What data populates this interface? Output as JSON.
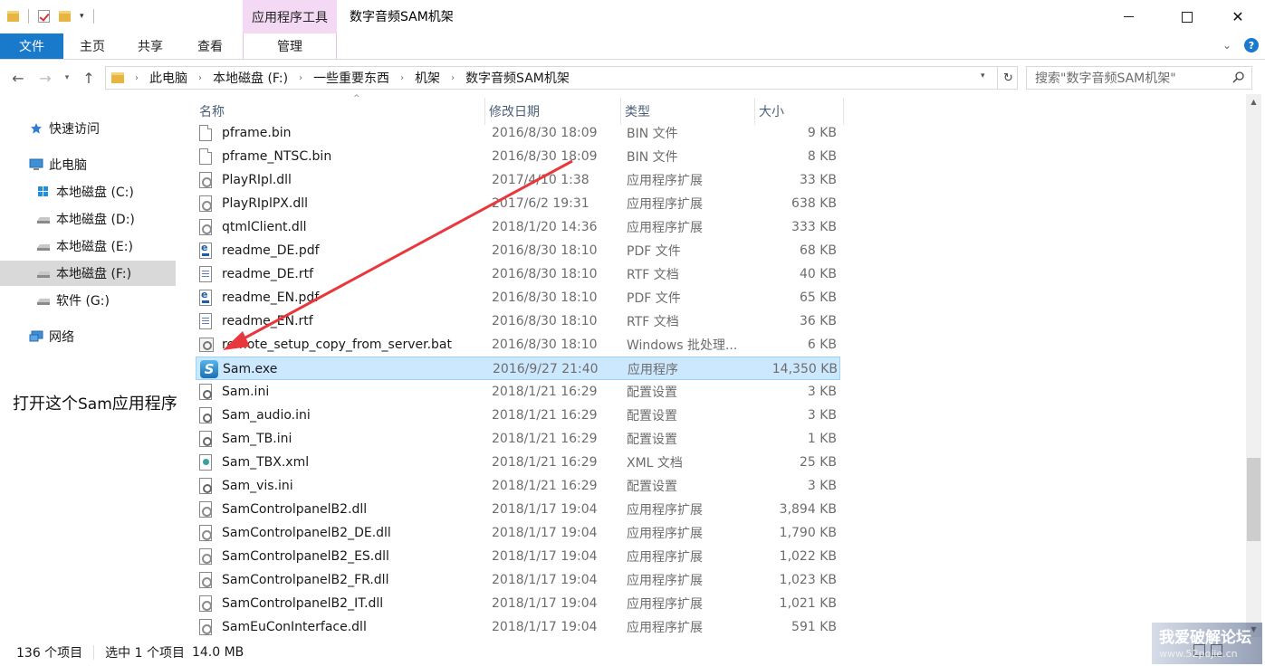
{
  "window": {
    "title": "数字音频SAM机架",
    "context_tab": "应用程序工具"
  },
  "ribbon": {
    "tabs": [
      {
        "label": "文件"
      },
      {
        "label": "主页"
      },
      {
        "label": "共享"
      },
      {
        "label": "查看"
      },
      {
        "label": "管理"
      }
    ]
  },
  "address": {
    "crumbs": [
      "此电脑",
      "本地磁盘 (F:)",
      "一些重要东西",
      "机架",
      "数字音频SAM机架"
    ]
  },
  "search": {
    "placeholder": "搜索\"数字音频SAM机架\""
  },
  "navpane": {
    "items": [
      {
        "label": "快速访问",
        "icon": "star-icon"
      },
      {
        "label": "此电脑",
        "icon": "computer-icon"
      },
      {
        "label": "本地磁盘 (C:)",
        "icon": "windows-drive-icon"
      },
      {
        "label": "本地磁盘 (D:)",
        "icon": "drive-icon"
      },
      {
        "label": "本地磁盘 (E:)",
        "icon": "drive-icon"
      },
      {
        "label": "本地磁盘 (F:)",
        "icon": "drive-icon"
      },
      {
        "label": "软件 (G:)",
        "icon": "drive-icon"
      },
      {
        "label": "网络",
        "icon": "network-icon"
      }
    ]
  },
  "annotation": {
    "prefix": "打开这个",
    "bold": "Sam",
    "suffix": "应用程序"
  },
  "columns": {
    "name": "名称",
    "date": "修改日期",
    "type": "类型",
    "size": "大小"
  },
  "files": [
    {
      "name": "pframe.bin",
      "date": "2016/8/30 18:09",
      "type": "BIN 文件",
      "size": "9 KB",
      "icon": "file"
    },
    {
      "name": "pframe_NTSC.bin",
      "date": "2016/8/30 18:09",
      "type": "BIN 文件",
      "size": "8 KB",
      "icon": "file"
    },
    {
      "name": "PlayRIpl.dll",
      "date": "2017/4/10 1:38",
      "type": "应用程序扩展",
      "size": "33 KB",
      "icon": "dll"
    },
    {
      "name": "PlayRIplPX.dll",
      "date": "2017/6/2 19:31",
      "type": "应用程序扩展",
      "size": "638 KB",
      "icon": "dll"
    },
    {
      "name": "qtmlClient.dll",
      "date": "2018/1/20 14:36",
      "type": "应用程序扩展",
      "size": "333 KB",
      "icon": "dll"
    },
    {
      "name": "readme_DE.pdf",
      "date": "2016/8/30 18:10",
      "type": "PDF 文件",
      "size": "68 KB",
      "icon": "pdf"
    },
    {
      "name": "readme_DE.rtf",
      "date": "2016/8/30 18:10",
      "type": "RTF 文档",
      "size": "40 KB",
      "icon": "rtf"
    },
    {
      "name": "readme_EN.pdf",
      "date": "2016/8/30 18:10",
      "type": "PDF 文件",
      "size": "65 KB",
      "icon": "pdf"
    },
    {
      "name": "readme_EN.rtf",
      "date": "2016/8/30 18:10",
      "type": "RTF 文档",
      "size": "36 KB",
      "icon": "rtf"
    },
    {
      "name": "remote_setup_copy_from_server.bat",
      "date": "2016/8/30 18:10",
      "type": "Windows 批处理...",
      "size": "6 KB",
      "icon": "bat"
    },
    {
      "name": "Sam.exe",
      "date": "2016/9/27 21:40",
      "type": "应用程序",
      "size": "14,350 KB",
      "icon": "exe",
      "selected": true
    },
    {
      "name": "Sam.ini",
      "date": "2018/1/21 16:29",
      "type": "配置设置",
      "size": "3 KB",
      "icon": "ini"
    },
    {
      "name": "Sam_audio.ini",
      "date": "2018/1/21 16:29",
      "type": "配置设置",
      "size": "3 KB",
      "icon": "ini"
    },
    {
      "name": "Sam_TB.ini",
      "date": "2018/1/21 16:29",
      "type": "配置设置",
      "size": "1 KB",
      "icon": "ini"
    },
    {
      "name": "Sam_TBX.xml",
      "date": "2018/1/21 16:29",
      "type": "XML 文档",
      "size": "25 KB",
      "icon": "xml"
    },
    {
      "name": "Sam_vis.ini",
      "date": "2018/1/21 16:29",
      "type": "配置设置",
      "size": "3 KB",
      "icon": "ini"
    },
    {
      "name": "SamControlpanelB2.dll",
      "date": "2018/1/17 19:04",
      "type": "应用程序扩展",
      "size": "3,894 KB",
      "icon": "dll"
    },
    {
      "name": "SamControlpanelB2_DE.dll",
      "date": "2018/1/17 19:04",
      "type": "应用程序扩展",
      "size": "1,790 KB",
      "icon": "dll"
    },
    {
      "name": "SamControlpanelB2_ES.dll",
      "date": "2018/1/17 19:04",
      "type": "应用程序扩展",
      "size": "1,022 KB",
      "icon": "dll"
    },
    {
      "name": "SamControlpanelB2_FR.dll",
      "date": "2018/1/17 19:04",
      "type": "应用程序扩展",
      "size": "1,023 KB",
      "icon": "dll"
    },
    {
      "name": "SamControlpanelB2_IT.dll",
      "date": "2018/1/17 19:04",
      "type": "应用程序扩展",
      "size": "1,021 KB",
      "icon": "dll"
    },
    {
      "name": "SamEuConInterface.dll",
      "date": "2018/1/17 19:04",
      "type": "应用程序扩展",
      "size": "591 KB",
      "icon": "dll"
    }
  ],
  "status": {
    "count": "136 个项目",
    "selected": "选中 1 个项目",
    "size": "14.0 MB"
  },
  "watermark": {
    "line1": "我爱破解论坛",
    "line2": "www.52pojie.cn"
  },
  "colors": {
    "accent": "#1979ca",
    "selection": "#cce8ff",
    "arrow": "#e8383d"
  }
}
